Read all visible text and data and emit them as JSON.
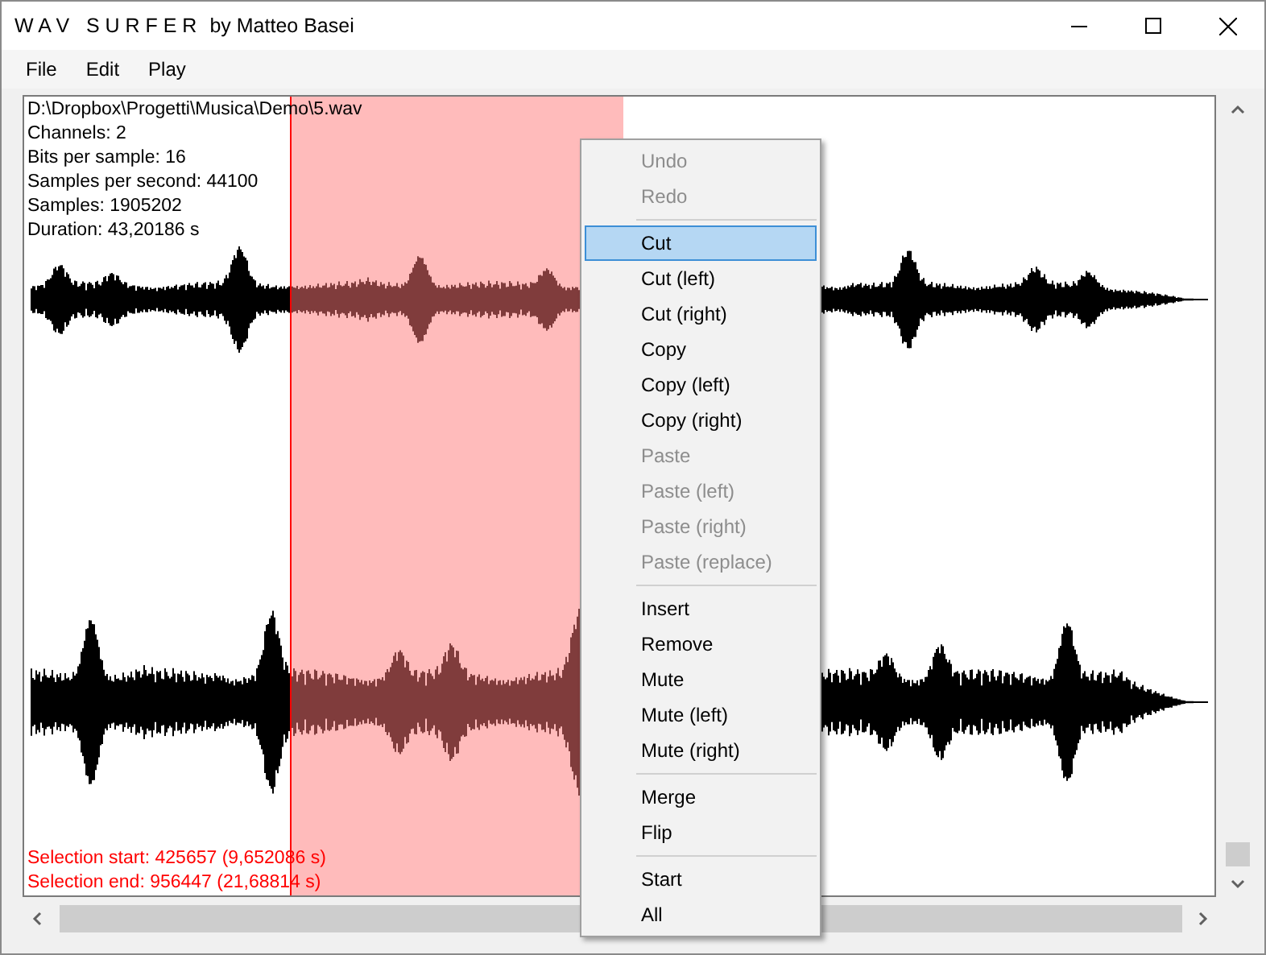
{
  "window": {
    "title": "W A V   S U R F E R",
    "subtitle": "by Matteo Basei"
  },
  "menu_bar": [
    {
      "label": "File"
    },
    {
      "label": "Edit"
    },
    {
      "label": "Play"
    }
  ],
  "file_info": [
    "D:\\Dropbox\\Progetti\\Musica\\Demo\\5.wav",
    "Channels: 2",
    "Bits per sample: 16",
    "Samples per second: 44100",
    "Samples: 1905202",
    "Duration: 43,20186 s"
  ],
  "selection_info": [
    "Selection start: 425657 (9,652086 s)",
    "Selection end: 956447 (21,68814 s)"
  ],
  "context_menu": [
    {
      "kind": "item",
      "label": "Undo",
      "disabled": true,
      "selected": false
    },
    {
      "kind": "item",
      "label": "Redo",
      "disabled": true,
      "selected": false
    },
    {
      "kind": "separator"
    },
    {
      "kind": "item",
      "label": "Cut",
      "disabled": false,
      "selected": true
    },
    {
      "kind": "item",
      "label": "Cut (left)",
      "disabled": false,
      "selected": false
    },
    {
      "kind": "item",
      "label": "Cut (right)",
      "disabled": false,
      "selected": false
    },
    {
      "kind": "item",
      "label": "Copy",
      "disabled": false,
      "selected": false
    },
    {
      "kind": "item",
      "label": "Copy (left)",
      "disabled": false,
      "selected": false
    },
    {
      "kind": "item",
      "label": "Copy (right)",
      "disabled": false,
      "selected": false
    },
    {
      "kind": "item",
      "label": "Paste",
      "disabled": true,
      "selected": false
    },
    {
      "kind": "item",
      "label": "Paste (left)",
      "disabled": true,
      "selected": false
    },
    {
      "kind": "item",
      "label": "Paste (right)",
      "disabled": true,
      "selected": false
    },
    {
      "kind": "item",
      "label": "Paste (replace)",
      "disabled": true,
      "selected": false
    },
    {
      "kind": "separator"
    },
    {
      "kind": "item",
      "label": "Insert",
      "disabled": false,
      "selected": false
    },
    {
      "kind": "item",
      "label": "Remove",
      "disabled": false,
      "selected": false
    },
    {
      "kind": "item",
      "label": "Mute",
      "disabled": false,
      "selected": false
    },
    {
      "kind": "item",
      "label": "Mute (left)",
      "disabled": false,
      "selected": false
    },
    {
      "kind": "item",
      "label": "Mute (right)",
      "disabled": false,
      "selected": false
    },
    {
      "kind": "separator"
    },
    {
      "kind": "item",
      "label": "Merge",
      "disabled": false,
      "selected": false
    },
    {
      "kind": "item",
      "label": "Flip",
      "disabled": false,
      "selected": false
    },
    {
      "kind": "separator"
    },
    {
      "kind": "item",
      "label": "Start",
      "disabled": false,
      "selected": false
    },
    {
      "kind": "item",
      "label": "All",
      "disabled": false,
      "selected": false
    }
  ]
}
